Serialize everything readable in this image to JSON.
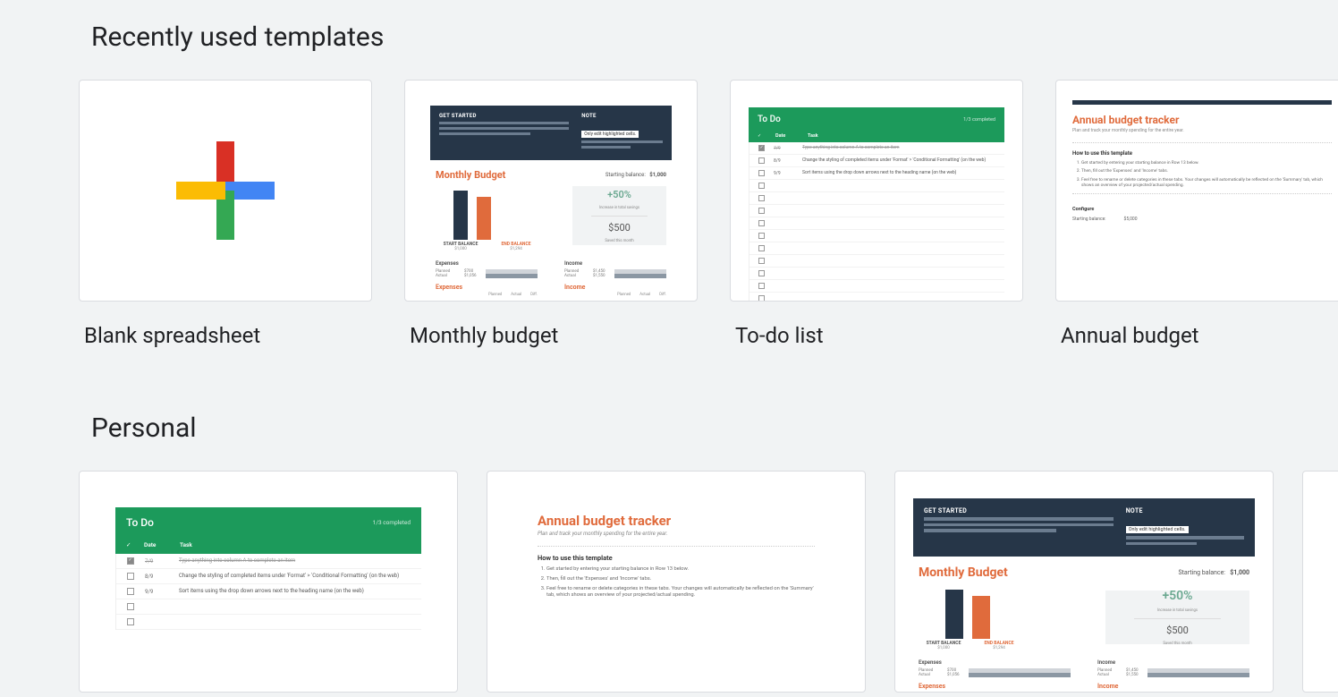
{
  "sections": {
    "recent": "Recently used templates",
    "personal": "Personal"
  },
  "templates": {
    "blank": {
      "label": "Blank spreadsheet"
    },
    "monthly": {
      "label": "Monthly budget"
    },
    "todo": {
      "label": "To-do list"
    },
    "annual": {
      "label": "Annual budget"
    }
  },
  "monthly_budget_preview": {
    "get_started_heading": "GET STARTED",
    "note_heading": "NOTE",
    "note_pill": "Only edit highlighted cells.",
    "title": "Monthly Budget",
    "starting_balance_label": "Starting balance:",
    "starting_balance_value": "$1,000",
    "bar_labels": {
      "start": "START BALANCE",
      "end": "END BALANCE"
    },
    "bar_values": {
      "start": "$1,000",
      "end": "$1,294"
    },
    "stat": {
      "pct": "+50%",
      "pct_sub": "Increase in total savings",
      "amt": "$500",
      "amt_sub": "Saved this month"
    },
    "expenses_heading": "Expenses",
    "income_heading": "Income",
    "rows": {
      "planned": "Planned",
      "actual": "Actual",
      "exp_planned": "$700",
      "exp_actual": "$1,056",
      "inc_planned": "$1,450",
      "inc_actual": "$1,550"
    },
    "footer_left": "Expenses",
    "footer_right": "Income",
    "footer_cols": [
      "Planned",
      "Actual",
      "Diff."
    ]
  },
  "todo_preview": {
    "title": "To Do",
    "count": "1/3 completed",
    "headers": {
      "check": "✓",
      "date": "Date",
      "task": "Task"
    },
    "rows": [
      {
        "checked": true,
        "date": "7/9",
        "task": "Type anything into column A to complete an item",
        "strike": true
      },
      {
        "checked": false,
        "date": "8/9",
        "task": "Change the styling of completed items under 'Format' > 'Conditional Formatting' (on the web)"
      },
      {
        "checked": false,
        "date": "9/9",
        "task": "Sort items using the drop down arrows next to the heading name (on the web)"
      },
      {
        "checked": false,
        "date": "",
        "task": ""
      },
      {
        "checked": false,
        "date": "",
        "task": ""
      },
      {
        "checked": false,
        "date": "",
        "task": ""
      },
      {
        "checked": false,
        "date": "",
        "task": ""
      },
      {
        "checked": false,
        "date": "",
        "task": ""
      },
      {
        "checked": false,
        "date": "",
        "task": ""
      },
      {
        "checked": false,
        "date": "",
        "task": ""
      },
      {
        "checked": false,
        "date": "",
        "task": ""
      },
      {
        "checked": false,
        "date": "",
        "task": ""
      },
      {
        "checked": false,
        "date": "",
        "task": ""
      }
    ]
  },
  "annual_preview": {
    "title": "Annual budget tracker",
    "subtitle": "Plan and track your monthly spending for the entire year.",
    "howto_heading": "How to use this template",
    "steps": [
      "Get started by entering your starting balance in Row 13 below.",
      "Then, fill out the 'Expenses' and 'Income' tabs.",
      "Feel free to rename or delete categories in these tabs. Your changes will automatically be reflected on the 'Summary' tab, which shows an overview of your projected/actual spending."
    ],
    "configure_heading": "Configure",
    "starting_balance_label": "Starting balance:",
    "starting_balance_value": "$5,000"
  }
}
